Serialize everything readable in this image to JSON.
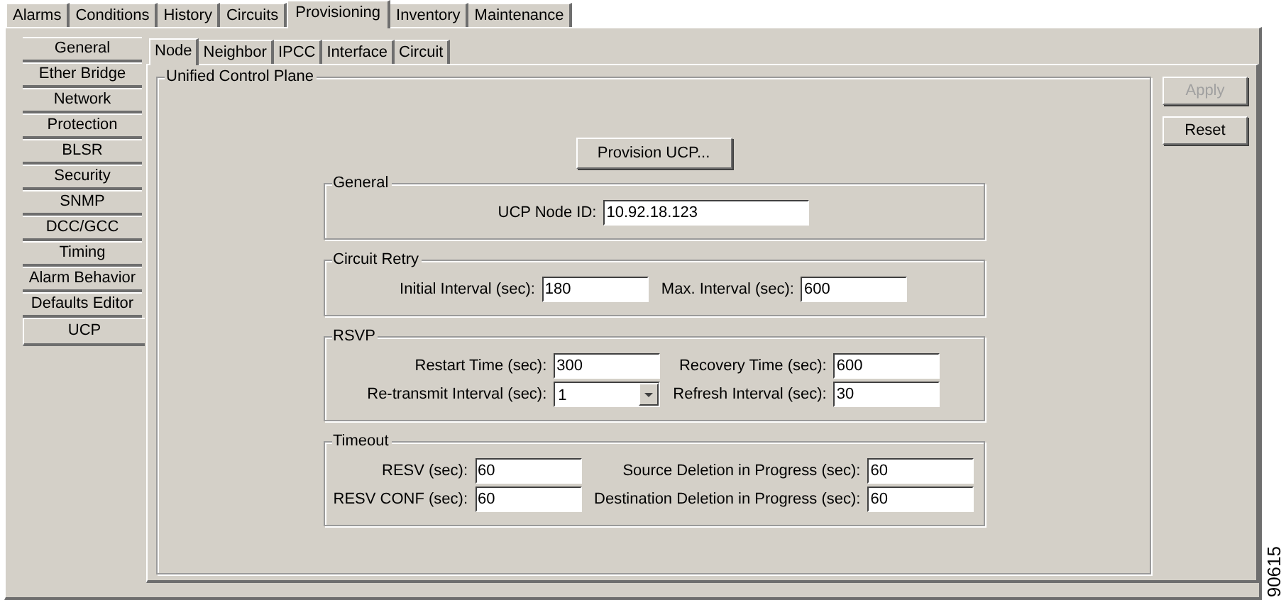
{
  "top_tabs": [
    {
      "label": "Alarms",
      "selected": false
    },
    {
      "label": "Conditions",
      "selected": false
    },
    {
      "label": "History",
      "selected": false
    },
    {
      "label": "Circuits",
      "selected": false
    },
    {
      "label": "Provisioning",
      "selected": true
    },
    {
      "label": "Inventory",
      "selected": false
    },
    {
      "label": "Maintenance",
      "selected": false
    }
  ],
  "sidebar": {
    "items": [
      {
        "label": "General",
        "selected": false
      },
      {
        "label": "Ether Bridge",
        "selected": false
      },
      {
        "label": "Network",
        "selected": false
      },
      {
        "label": "Protection",
        "selected": false
      },
      {
        "label": "BLSR",
        "selected": false
      },
      {
        "label": "Security",
        "selected": false
      },
      {
        "label": "SNMP",
        "selected": false
      },
      {
        "label": "DCC/GCC",
        "selected": false
      },
      {
        "label": "Timing",
        "selected": false
      },
      {
        "label": "Alarm Behavior",
        "selected": false
      },
      {
        "label": "Defaults Editor",
        "selected": false
      },
      {
        "label": "UCP",
        "selected": true
      }
    ]
  },
  "sub_tabs": [
    {
      "label": "Node",
      "selected": true
    },
    {
      "label": "Neighbor",
      "selected": false
    },
    {
      "label": "IPCC",
      "selected": false
    },
    {
      "label": "Interface",
      "selected": false
    },
    {
      "label": "Circuit",
      "selected": false
    }
  ],
  "panel": {
    "title": "Unified Control Plane",
    "provision_button": "Provision UCP...",
    "groups": [
      {
        "title": "General",
        "rows": [
          [
            {
              "label": "UCP Node ID:",
              "value": "10.92.18.123",
              "kind": "text"
            }
          ]
        ]
      },
      {
        "title": "Circuit Retry",
        "rows": [
          [
            {
              "label": "Initial Interval (sec):",
              "value": "180",
              "kind": "text"
            },
            {
              "label": "Max. Interval (sec):",
              "value": "600",
              "kind": "text"
            }
          ]
        ]
      },
      {
        "title": "RSVP",
        "rows": [
          [
            {
              "label": "Restart Time (sec):",
              "value": "300",
              "kind": "text"
            },
            {
              "label": "Recovery Time (sec):",
              "value": "600",
              "kind": "text"
            }
          ],
          [
            {
              "label": "Re-transmit Interval (sec):",
              "value": "1",
              "kind": "dropdown"
            },
            {
              "label": "Refresh Interval (sec):",
              "value": "30",
              "kind": "text"
            }
          ]
        ]
      },
      {
        "title": "Timeout",
        "rows": [
          [
            {
              "label": "RESV (sec):",
              "value": "60",
              "kind": "text"
            },
            {
              "label": "Source Deletion in Progress (sec):",
              "value": "60",
              "kind": "text"
            }
          ],
          [
            {
              "label": "RESV CONF (sec):",
              "value": "60",
              "kind": "text"
            },
            {
              "label": "Destination Deletion in Progress (sec):",
              "value": "60",
              "kind": "text"
            }
          ]
        ]
      }
    ]
  },
  "buttons": [
    {
      "label": "Apply",
      "disabled": true
    },
    {
      "label": "Reset",
      "disabled": false
    }
  ],
  "figure_id": "90615"
}
